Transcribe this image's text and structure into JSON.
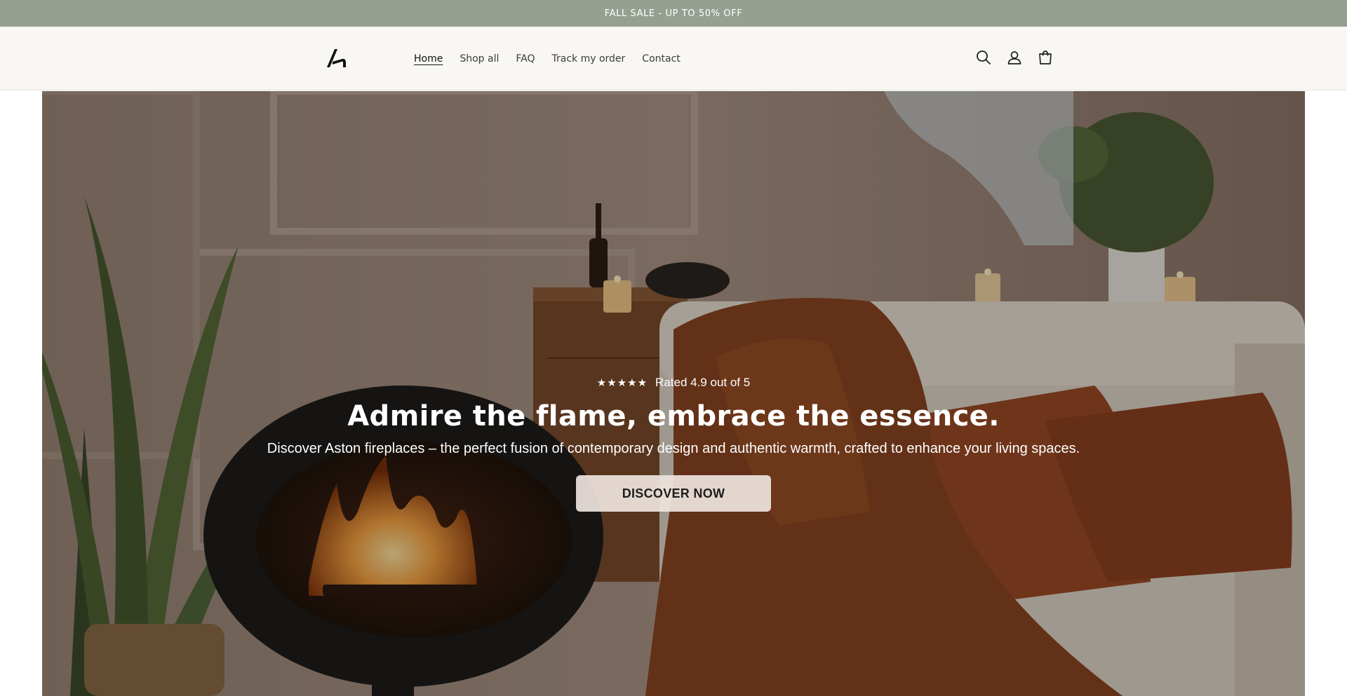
{
  "announcement": {
    "text": "FALL SALE - UP TO 50% OFF"
  },
  "header": {
    "logo": "Aston logo",
    "nav": [
      {
        "label": "Home",
        "active": true
      },
      {
        "label": "Shop all",
        "active": false
      },
      {
        "label": "FAQ",
        "active": false
      },
      {
        "label": "Track my order",
        "active": false
      },
      {
        "label": "Contact",
        "active": false
      }
    ],
    "icons": [
      "search-icon",
      "account-icon",
      "cart-icon"
    ]
  },
  "hero": {
    "rating_stars": 5,
    "rating_text": "Rated 4.9 out of 5",
    "headline": "Admire the flame, embrace the essence.",
    "subtext": "Discover Aston fireplaces – the perfect fusion of contemporary design and authentic warmth, crafted to enhance your living spaces.",
    "cta_label": "DISCOVER NOW"
  },
  "colors": {
    "announcement_bg": "#96a091",
    "header_bg": "#f8f7f3",
    "cta_bg": "#eee4de"
  }
}
